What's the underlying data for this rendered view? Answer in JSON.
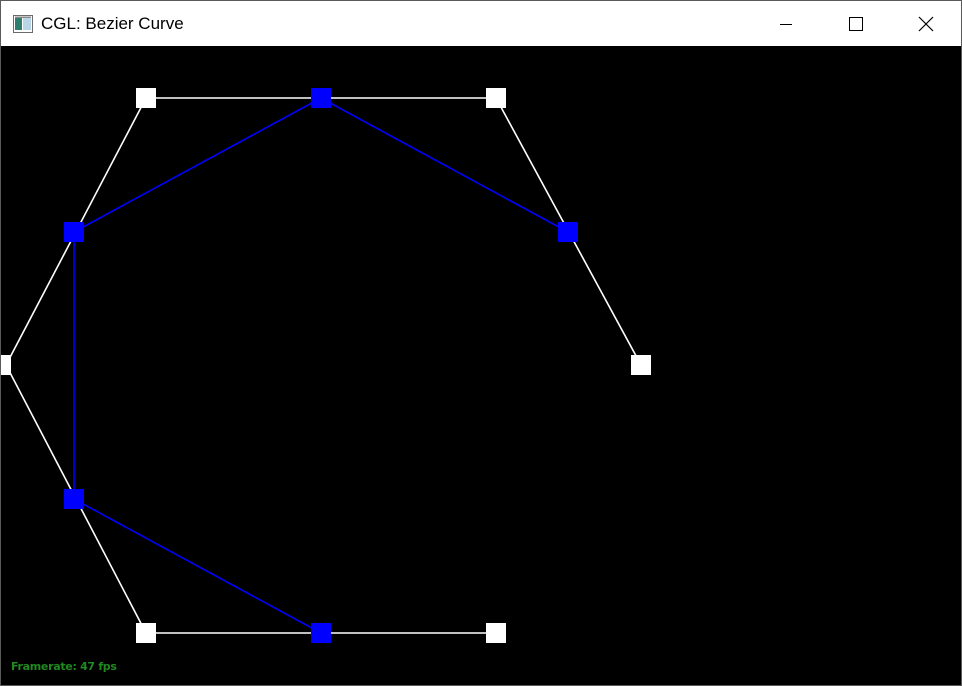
{
  "window": {
    "title": "CGL: Bezier Curve",
    "app_icon": "cgl-app-icon",
    "controls": [
      {
        "name": "minimize-icon",
        "symbol": "—"
      },
      {
        "name": "maximize-icon",
        "symbol": "☐"
      },
      {
        "name": "close-icon",
        "symbol": "✕"
      }
    ]
  },
  "canvas": {
    "background": "#000000",
    "control_polygon_color": "#ffffff",
    "curve_polygon_color": "#0000ff",
    "status": {
      "framerate_label": "Framerate: 47 fps",
      "color": "#1f8a1f"
    }
  }
}
